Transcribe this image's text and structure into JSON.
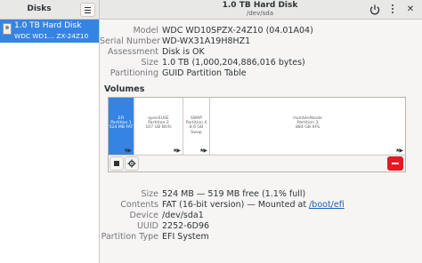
{
  "sidebar": {
    "title": "Disks",
    "disk": {
      "name": "1.0 TB Hard Disk",
      "model": "WDC WD1… ZX-24Z10"
    }
  },
  "header": {
    "title": "1.0 TB Hard Disk",
    "subtitle": "/dev/sda"
  },
  "drive": {
    "model_key": "Model",
    "model_val": "WDC WD10SPZX-24Z10 (04.01A04)",
    "serial_key": "Serial Number",
    "serial_val": "WD-WX31A19H8HZ1",
    "assess_key": "Assessment",
    "assess_val": "Disk is OK",
    "size_key": "Size",
    "size_val": "1.0 TB (1,000,204,886,016 bytes)",
    "part_key": "Partitioning",
    "part_val": "GUID Partition Table"
  },
  "volumes_title": "Volumes",
  "partitions": [
    {
      "line1": "EFI",
      "line2": "Partition 1",
      "line3": "524 MB FAT"
    },
    {
      "line1": "openSUSE",
      "line2": "Partition 2",
      "line3": "107 GB Btrfs"
    },
    {
      "line1": "SWAP",
      "line2": "Partition 4",
      "line3": "8.6 GB Swap"
    },
    {
      "line1": "HumbleAbode",
      "line2": "Partition 3",
      "line3": "884 GB XFS"
    }
  ],
  "volume": {
    "size_key": "Size",
    "size_val": "524 MB — 519 MB free (1.1% full)",
    "contents_key": "Contents",
    "contents_val": "FAT (16-bit version) — Mounted at ",
    "contents_link": "/boot/efi",
    "device_key": "Device",
    "device_val": "/dev/sda1",
    "uuid_key": "UUID",
    "uuid_val": "2252-6D96",
    "ptype_key": "Partition Type",
    "ptype_val": "EFI System"
  },
  "colors": {
    "accent": "#3584e4",
    "danger": "#e01b24",
    "link": "#1a5fb4"
  },
  "icons": [
    "menu-icon",
    "power-icon",
    "kebab-menu-icon",
    "close-icon",
    "hard-disk-icon",
    "stop-icon",
    "gear-icon",
    "minus-icon"
  ]
}
